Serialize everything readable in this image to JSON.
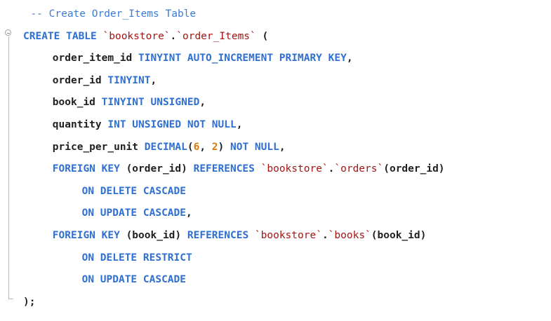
{
  "editor": {
    "language": "SQL",
    "colors": {
      "keyword": "#2f6fd0",
      "identifier": "#1f1f1f",
      "string": "#a31515",
      "number": "#d97706",
      "comment": "#3b7bd6",
      "fold_gutter": "#b8b8b8"
    },
    "gutter_icons": [
      "fold-collapse-icon"
    ],
    "lines": [
      {
        "indent": 1,
        "tokens": [
          {
            "t": "comment",
            "v": "-- Create Order_Items Table"
          }
        ]
      },
      {
        "indent": 0,
        "fold": true,
        "tokens": [
          {
            "t": "keyword",
            "v": "CREATE TABLE "
          },
          {
            "t": "string",
            "v": "`bookstore`"
          },
          {
            "t": "identifier",
            "v": "."
          },
          {
            "t": "string",
            "v": "`order_Items`"
          },
          {
            "t": "identifier",
            "v": " ("
          }
        ]
      },
      {
        "indent": 4,
        "tokens": [
          {
            "t": "identifier",
            "v": "order_item_id "
          },
          {
            "t": "keyword",
            "v": "TINYINT AUTO_INCREMENT PRIMARY KEY"
          },
          {
            "t": "identifier",
            "v": ","
          }
        ]
      },
      {
        "indent": 4,
        "tokens": [
          {
            "t": "identifier",
            "v": "order_id "
          },
          {
            "t": "keyword",
            "v": "TINYINT"
          },
          {
            "t": "identifier",
            "v": ","
          }
        ]
      },
      {
        "indent": 4,
        "tokens": [
          {
            "t": "identifier",
            "v": "book_id "
          },
          {
            "t": "keyword",
            "v": "TINYINT UNSIGNED"
          },
          {
            "t": "identifier",
            "v": ","
          }
        ]
      },
      {
        "indent": 4,
        "tokens": [
          {
            "t": "identifier",
            "v": "quantity "
          },
          {
            "t": "keyword",
            "v": "INT UNSIGNED NOT NULL"
          },
          {
            "t": "identifier",
            "v": ","
          }
        ]
      },
      {
        "indent": 4,
        "tokens": [
          {
            "t": "identifier",
            "v": "price_per_unit "
          },
          {
            "t": "keyword",
            "v": "DECIMAL"
          },
          {
            "t": "identifier",
            "v": "("
          },
          {
            "t": "number",
            "v": "6"
          },
          {
            "t": "identifier",
            "v": ", "
          },
          {
            "t": "number",
            "v": "2"
          },
          {
            "t": "identifier",
            "v": ") "
          },
          {
            "t": "keyword",
            "v": "NOT NULL"
          },
          {
            "t": "identifier",
            "v": ","
          }
        ]
      },
      {
        "indent": 4,
        "tokens": [
          {
            "t": "keyword",
            "v": "FOREIGN KEY "
          },
          {
            "t": "identifier",
            "v": "(order_id) "
          },
          {
            "t": "keyword",
            "v": "REFERENCES "
          },
          {
            "t": "string",
            "v": "`bookstore`"
          },
          {
            "t": "identifier",
            "v": "."
          },
          {
            "t": "string",
            "v": "`orders`"
          },
          {
            "t": "identifier",
            "v": "(order_id)"
          }
        ]
      },
      {
        "indent": 8,
        "tokens": [
          {
            "t": "keyword",
            "v": "ON DELETE CASCADE"
          }
        ]
      },
      {
        "indent": 8,
        "tokens": [
          {
            "t": "keyword",
            "v": "ON UPDATE CASCADE"
          },
          {
            "t": "identifier",
            "v": ","
          }
        ]
      },
      {
        "indent": 4,
        "tokens": [
          {
            "t": "keyword",
            "v": "FOREIGN KEY "
          },
          {
            "t": "identifier",
            "v": "(book_id) "
          },
          {
            "t": "keyword",
            "v": "REFERENCES "
          },
          {
            "t": "string",
            "v": "`bookstore`"
          },
          {
            "t": "identifier",
            "v": "."
          },
          {
            "t": "string",
            "v": "`books`"
          },
          {
            "t": "identifier",
            "v": "(book_id)"
          }
        ]
      },
      {
        "indent": 8,
        "tokens": [
          {
            "t": "keyword",
            "v": "ON DELETE RESTRICT"
          }
        ]
      },
      {
        "indent": 8,
        "tokens": [
          {
            "t": "keyword",
            "v": "ON UPDATE CASCADE"
          }
        ]
      },
      {
        "indent": 0,
        "tokens": [
          {
            "t": "identifier",
            "v": ");"
          }
        ]
      }
    ]
  }
}
